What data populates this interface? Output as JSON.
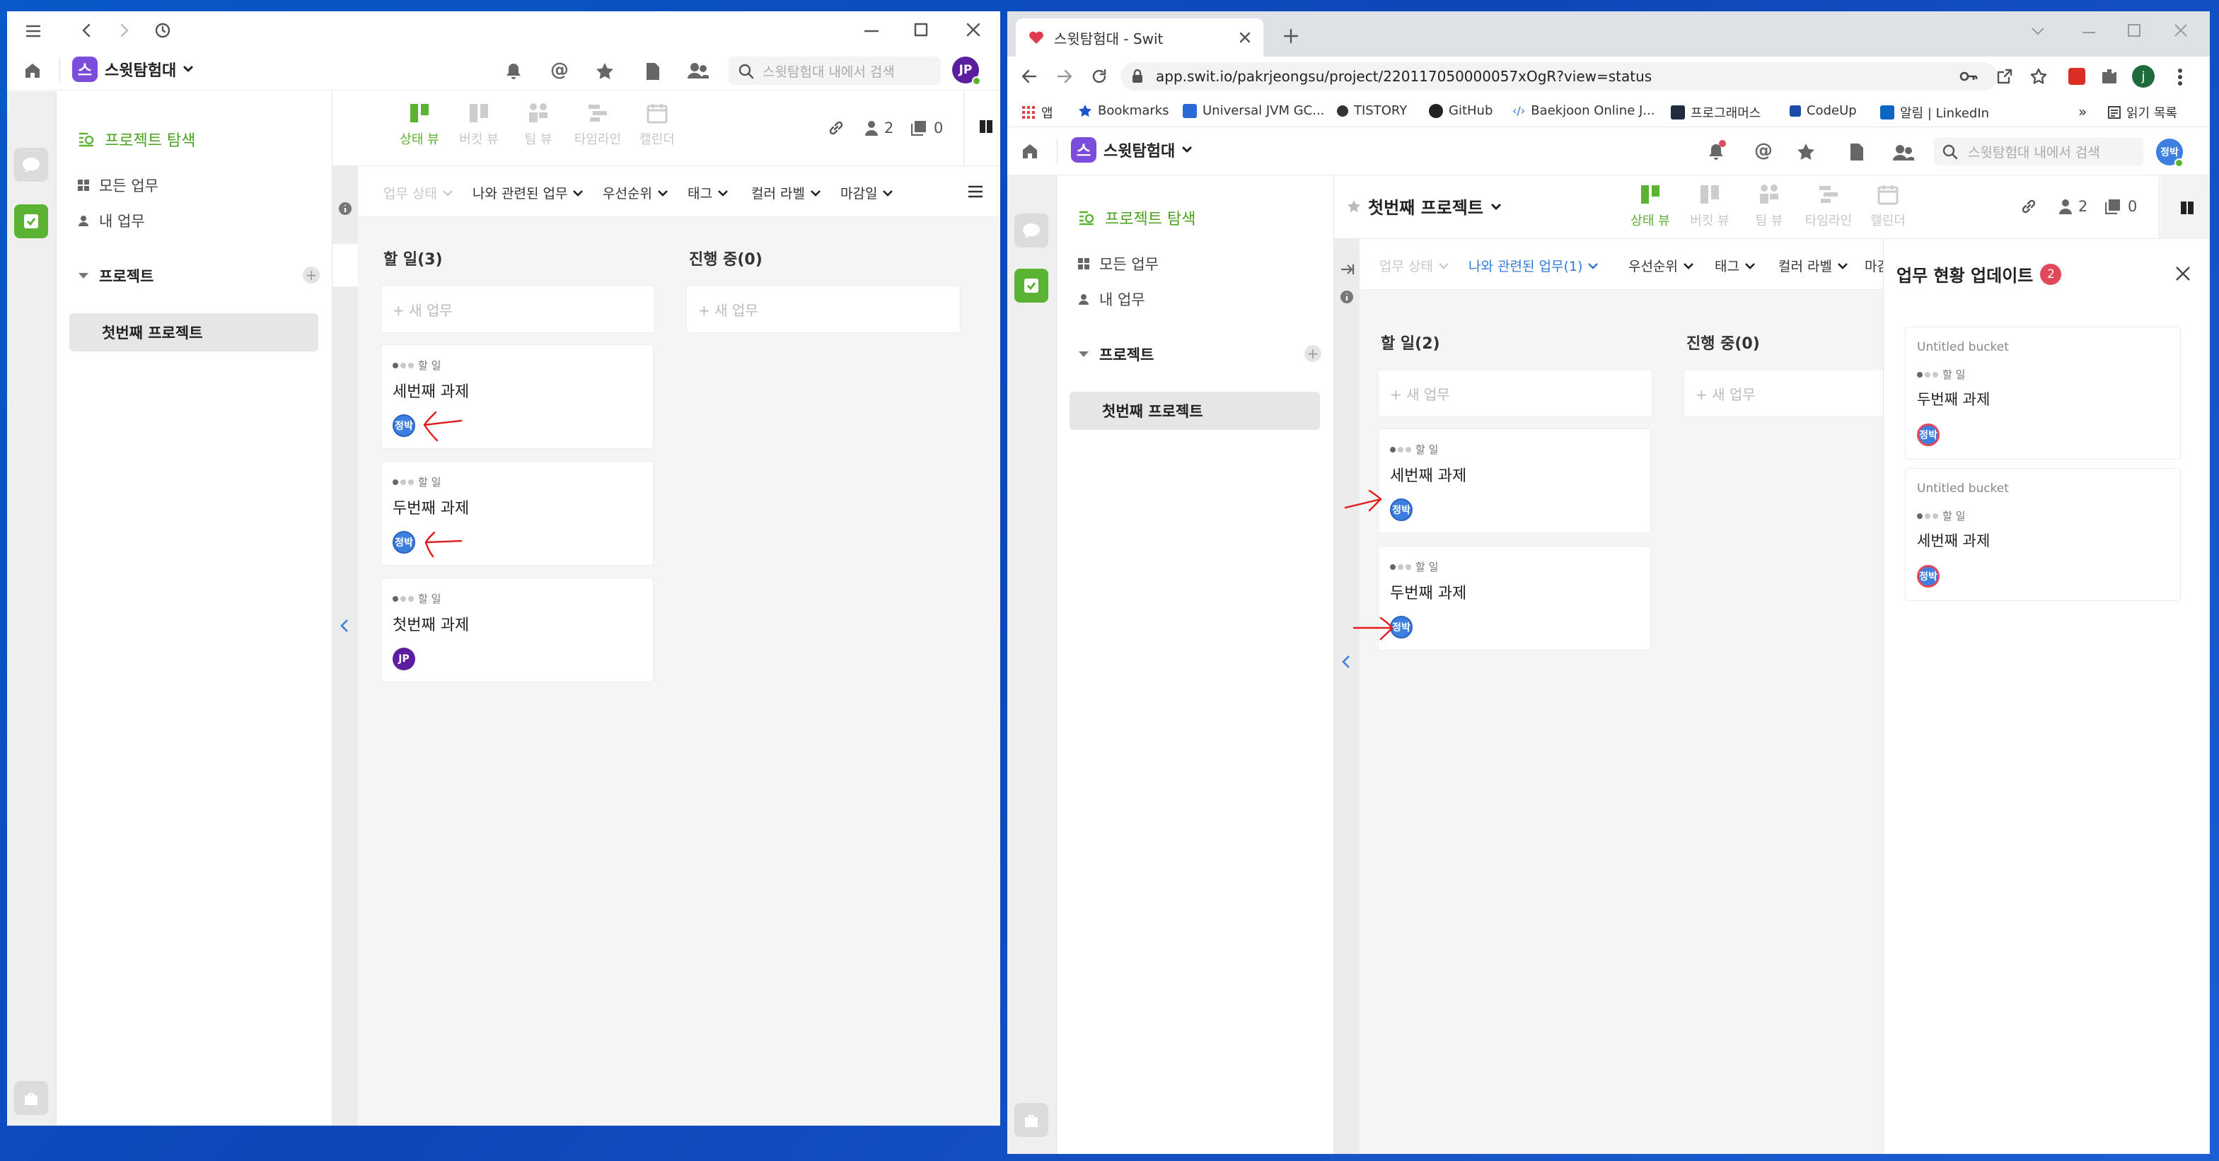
{
  "left_window": {
    "workspace_name": "스윗탐험대",
    "workspace_logo": "스",
    "search_placeholder": "스윗탐험대 내에서 검색",
    "user_initials": "JP",
    "sidebar": {
      "explore": "프로젝트 탐색",
      "all_tasks": "모든 업무",
      "my_tasks": "내 업무",
      "projects_header": "프로젝트",
      "project_item": "첫번째 프로젝트"
    },
    "view_tabs": [
      "상태 뷰",
      "버킷 뷰",
      "팀 뷰",
      "타임라인",
      "캘린더"
    ],
    "member_count": "2",
    "file_count": "0",
    "filters": [
      "업무 상태",
      "나와 관련된 업무",
      "우선순위",
      "태그",
      "컬러 라벨",
      "마감일"
    ],
    "columns": [
      {
        "title": "할 일(3)",
        "new_task": "+ 새 업무"
      },
      {
        "title": "진행 중(0)",
        "new_task": "+ 새 업무"
      }
    ],
    "cards": [
      {
        "status": "할 일",
        "title": "세번째 과제",
        "assignee": "정박"
      },
      {
        "status": "할 일",
        "title": "두번째 과제",
        "assignee": "정박"
      },
      {
        "status": "할 일",
        "title": "첫번째 과제",
        "assignee": "JP"
      }
    ]
  },
  "right_window": {
    "tab_title": "스윗탐험대 - Swit",
    "url": "app.swit.io/pakrjeongsu/project/220117050000057xOgR?view=status",
    "profile_initial": "j",
    "bookmarks": [
      "앱",
      "Bookmarks",
      "Universal JVM GC...",
      "TISTORY",
      "GitHub",
      "Baekjoon Online J...",
      "프로그래머스",
      "CodeUp",
      "알림 | LinkedIn"
    ],
    "bookmarks_more": "»",
    "reading_list": "읽기 목록",
    "workspace_name": "스윗탐험대",
    "workspace_logo": "스",
    "search_placeholder": "스윗탐험대 내에서 검색",
    "user_initials": "정박",
    "sidebar": {
      "explore": "프로젝트 탐색",
      "all_tasks": "모든 업무",
      "my_tasks": "내 업무",
      "projects_header": "프로젝트",
      "project_item": "첫번째 프로젝트"
    },
    "project_title": "첫번째 프로젝트",
    "view_tabs": [
      "상태 뷰",
      "버킷 뷰",
      "팀 뷰",
      "타임라인",
      "캘린더"
    ],
    "member_count": "2",
    "file_count": "0",
    "filters": [
      "업무 상태",
      "나와 관련된 업무(1)",
      "우선순위",
      "태그",
      "컬러 라벨",
      "마감"
    ],
    "columns": [
      {
        "title": "할 일(2)",
        "new_task": "+ 새 업무"
      },
      {
        "title": "진행 중(0)",
        "new_task": "+ 새 업무"
      }
    ],
    "cards": [
      {
        "status": "할 일",
        "title": "세번째 과제",
        "assignee": "정박"
      },
      {
        "status": "할 일",
        "title": "두번째 과제",
        "assignee": "정박"
      }
    ],
    "panel": {
      "title": "업무 현황 업데이트",
      "badge": "2",
      "items": [
        {
          "bucket": "Untitled bucket",
          "status": "할 일",
          "title": "두번째 과제",
          "assignee": "정박"
        },
        {
          "bucket": "Untitled bucket",
          "status": "할 일",
          "title": "세번째 과제",
          "assignee": "정박"
        }
      ]
    }
  },
  "colors": {
    "accent_green": "#5ab431",
    "workspace_purple": "#7c4ddb",
    "desktop_blue": "#0a58c9",
    "annotation_red": "#e21b1b",
    "badge_red": "#e0495a"
  }
}
